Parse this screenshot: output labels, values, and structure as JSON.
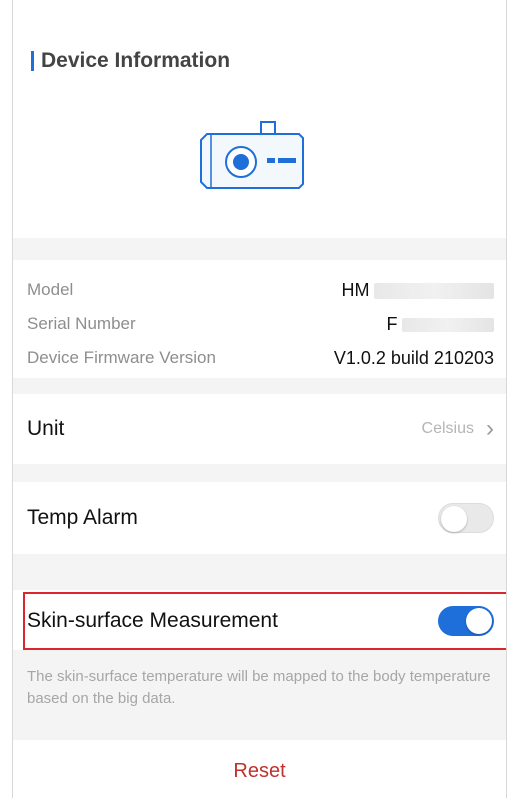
{
  "header": {
    "title": "Device Information"
  },
  "device": {
    "icon": "thermal-camera-icon",
    "accent": "#1e6fd9"
  },
  "info": [
    {
      "label": "Model",
      "value": "HM"
    },
    {
      "label": "Serial Number",
      "value": "F"
    },
    {
      "label": "Device Firmware Version",
      "value": "V1.0.2 build 210203"
    }
  ],
  "settings": {
    "unit": {
      "label": "Unit",
      "value": "Celsius"
    },
    "temp_alarm": {
      "label": "Temp Alarm",
      "enabled": false
    },
    "skin_surface": {
      "label": "Skin-surface Measurement",
      "enabled": true
    }
  },
  "description": "The skin-surface temperature will be mapped to the body temperature based on the big data.",
  "reset_label": "Reset",
  "colors": {
    "accent": "#1e6fd9",
    "highlight_border": "#d9262c",
    "reset_text": "#c0322e"
  }
}
